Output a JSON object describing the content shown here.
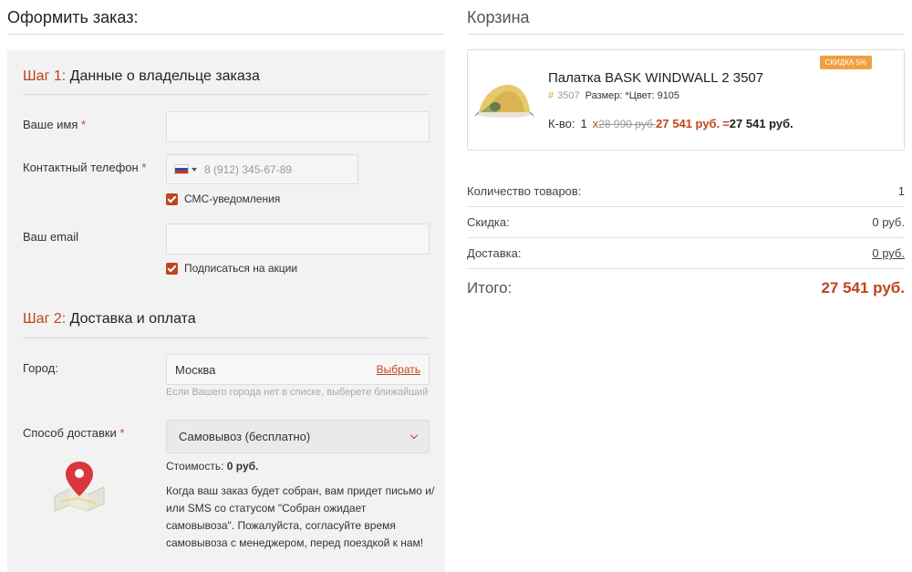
{
  "order": {
    "title": "Оформить заказ:",
    "step1": {
      "num": "Шаг 1:",
      "title": "Данные о владельце заказа"
    },
    "name_label": "Ваше имя",
    "phone_label": "Контактный телефон",
    "phone_placeholder": "8 (912) 345-67-89",
    "sms_label": "СМС-уведомления",
    "email_label": "Ваш email",
    "subscribe_label": "Подписаться на акции",
    "required_mark": "*",
    "step2": {
      "num": "Шаг 2:",
      "title": "Доставка и оплата"
    },
    "city_label": "Город:",
    "city_value": "Москва",
    "city_choose": "Выбрать",
    "city_hint": "Если Вашего города нет в списке, выберете ближайший",
    "delivery_label": "Способ доставки",
    "delivery_value": "Самовывоз (бесплатно)",
    "cost_label": "Стоимость:",
    "cost_value": "0 руб.",
    "delivery_text": "Когда ваш заказ будет собран, вам придет письмо и/или SMS со статусом \"Собран ожидает самовывоза\". Пожалуйста, согласуйте время самовывоза с менеджером, перед поездкой к нам!"
  },
  "cart": {
    "title": "Корзина",
    "product": {
      "badge": "СКИДКА 5%",
      "name": "Палатка BASK WINDWALL 2 3507",
      "hash": "#",
      "sku": "3507",
      "meta": "Размер: *Цвет: 9105",
      "qty_label": "К-во:",
      "qty": "1",
      "times": "x",
      "old_price": "28 990 руб.",
      "new_price": "27 541 руб.",
      "eq": "=",
      "line_total": "27 541 руб."
    },
    "summary": [
      {
        "label": "Количество товаров:",
        "value": "1"
      },
      {
        "label": "Скидка:",
        "value": "0 руб."
      },
      {
        "label": "Доставка:",
        "value": "0 руб."
      }
    ],
    "total_label": "Итого:",
    "total_value": "27 541 руб."
  },
  "colors": {
    "accent": "#c0441c",
    "badge": "#f0a040",
    "panel": "#f2f2f2"
  },
  "icons": [
    "flag-ru-icon",
    "map-pin-icon",
    "tent-image",
    "chevron-down-icon",
    "checkbox-icon"
  ]
}
